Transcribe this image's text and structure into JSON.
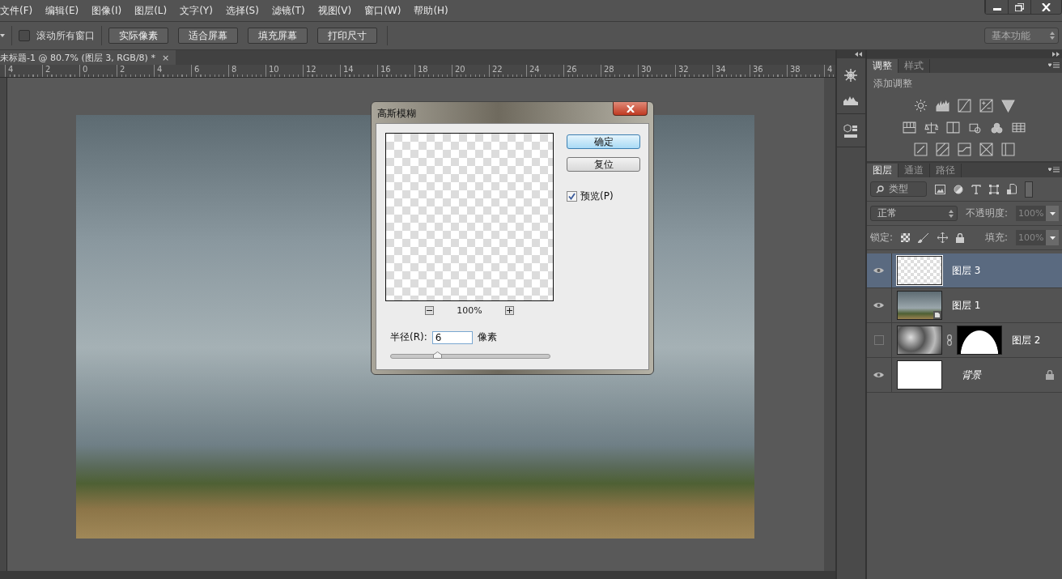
{
  "menu": [
    "文件(F)",
    "编辑(E)",
    "图像(I)",
    "图层(L)",
    "文字(Y)",
    "选择(S)",
    "滤镜(T)",
    "视图(V)",
    "窗口(W)",
    "帮助(H)"
  ],
  "options_bar": {
    "scroll_all": {
      "label": "滚动所有窗口",
      "checked": false
    },
    "buttons": [
      "实际像素",
      "适合屏幕",
      "填充屏幕",
      "打印尺寸"
    ],
    "workspace": "基本功能"
  },
  "document_tab": {
    "title": "未标题-1 @ 80.7% (图层 3, RGB/8) *",
    "close": "×"
  },
  "ruler": {
    "labels": [
      "4",
      "2",
      "0",
      "2",
      "4",
      "6",
      "8",
      "10",
      "12",
      "14",
      "16",
      "18",
      "20",
      "22",
      "24",
      "26",
      "28",
      "30",
      "32",
      "34",
      "36",
      "38",
      "4"
    ]
  },
  "dialog": {
    "title": "高斯模糊",
    "zoom": "100%",
    "buttons": [
      {
        "label": "确定",
        "default": true
      },
      {
        "label": "复位",
        "default": false
      }
    ],
    "preview": {
      "label": "预览(P)",
      "checked": true
    },
    "radius": {
      "label": "半径(R):",
      "value": "6",
      "unit": "像素",
      "level": 0.29
    }
  },
  "adjustments_panel": {
    "tabs": [
      {
        "label": "调整",
        "selected": true
      },
      {
        "label": "样式",
        "selected": false
      }
    ],
    "title": "添加调整"
  },
  "layers_panel": {
    "tabs": [
      {
        "label": "图层",
        "selected": true
      },
      {
        "label": "通道",
        "selected": false
      },
      {
        "label": "路径",
        "selected": false
      }
    ],
    "filter": "类型",
    "blend_mode": "正常",
    "opacity_label": "不透明度:",
    "opacity": "100%",
    "lock_label": "锁定:",
    "fill_label": "填充:",
    "fill": "100%",
    "layers": [
      {
        "name": "图层 3",
        "visible": true,
        "selected": true,
        "kind": "transparent",
        "mask": false,
        "smart": false,
        "locked": false
      },
      {
        "name": "图层 1",
        "visible": true,
        "selected": false,
        "kind": "photo",
        "mask": false,
        "smart": true,
        "locked": false
      },
      {
        "name": "图层 2",
        "visible": false,
        "selected": false,
        "kind": "clouds",
        "mask": true,
        "smart": false,
        "locked": false
      },
      {
        "name": "背景",
        "visible": true,
        "selected": false,
        "kind": "white",
        "mask": false,
        "smart": false,
        "locked": true
      }
    ]
  }
}
